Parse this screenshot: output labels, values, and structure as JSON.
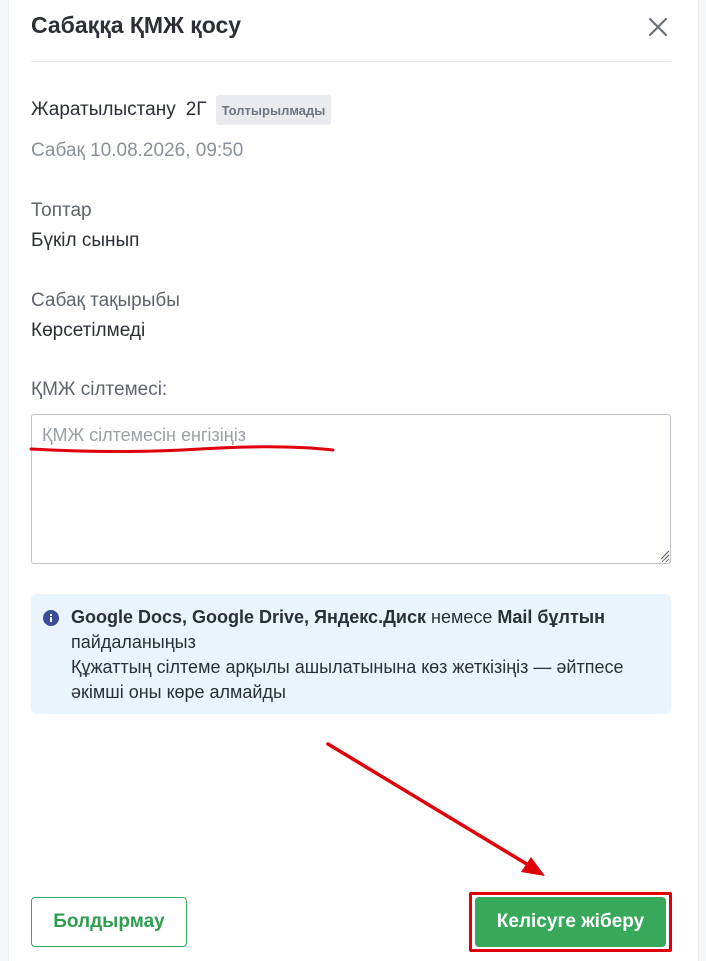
{
  "modal": {
    "title": "Сабаққа ҚМЖ қосу",
    "close_icon": "close-icon"
  },
  "lesson": {
    "subject": "Жаратылыстану",
    "grade": "2Г",
    "status_badge": "Толтырылмады",
    "date": "Сабақ 10.08.2026, 09:50"
  },
  "groups": {
    "label": "Топтар",
    "value": "Бүкіл сынып"
  },
  "topic": {
    "label": "Сабақ тақырыбы",
    "value": "Көрсетілмеді"
  },
  "link_field": {
    "label": "ҚМЖ сілтемесі:",
    "value": "",
    "placeholder": "ҚМЖ сілтемесін енгізіңіз"
  },
  "info": {
    "icon": "info-icon",
    "services": "Google Docs, Google Drive, Яндекс.Диск",
    "or_word": "немесе",
    "mail_cloud": "Mail бұлтын",
    "use_word": "пайдаланыңыз",
    "line2": "Құжаттың сілтеме арқылы ашылатынына көз жеткізіңіз — әйтпесе әкімші оны көре алмайды"
  },
  "actions": {
    "cancel_label": "Болдырмау",
    "submit_label": "Келісуге жіберу"
  },
  "colors": {
    "primary_green": "#38a85a",
    "annotation_red": "#e0000a",
    "info_bg": "#eaf4fd",
    "info_icon": "#3b4b9a"
  }
}
